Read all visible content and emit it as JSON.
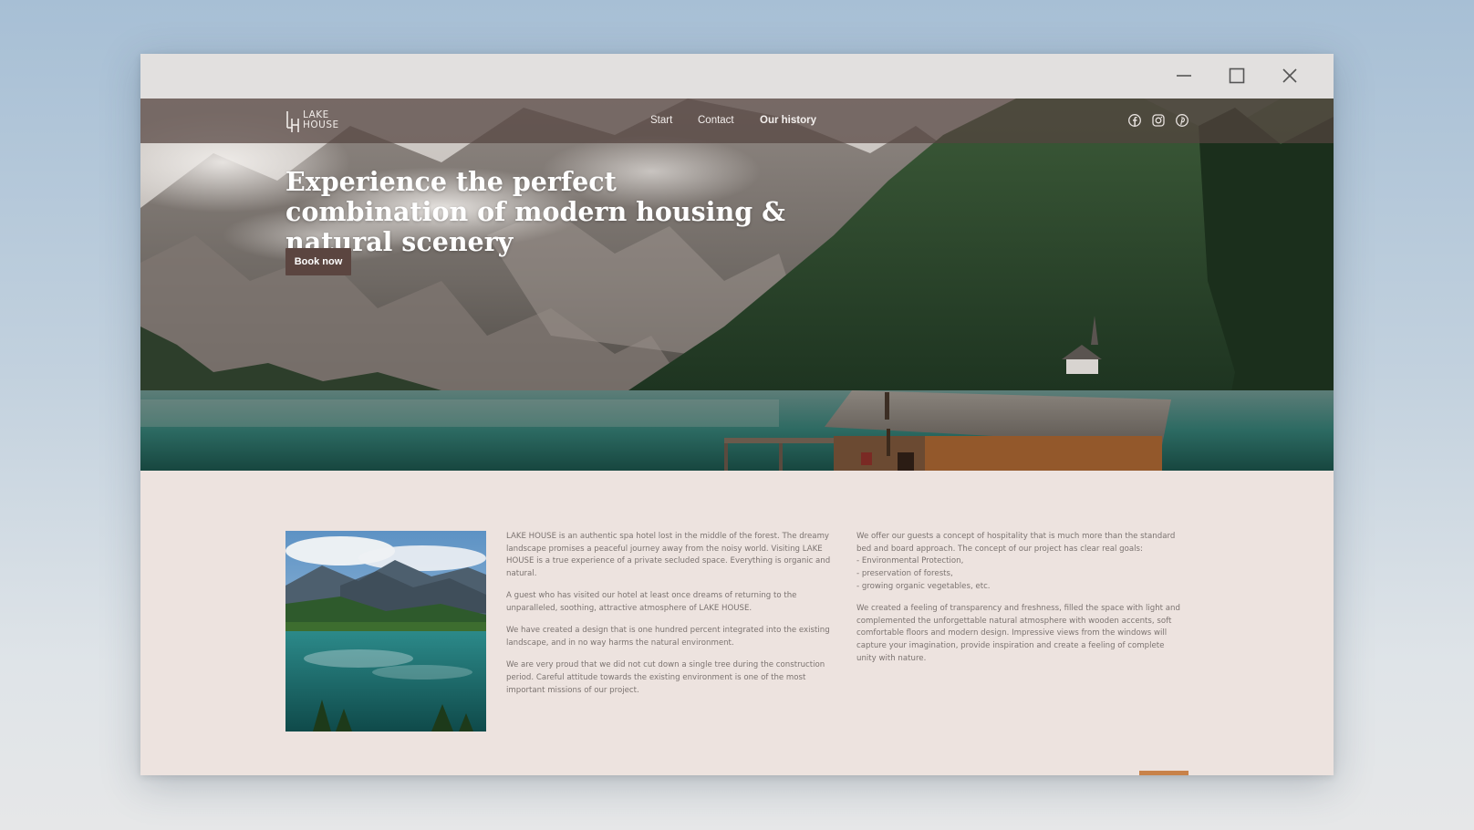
{
  "window": {
    "controls": {
      "minimize_icon": "minimize-icon",
      "maximize_icon": "maximize-icon",
      "close_icon": "close-icon"
    }
  },
  "nav": {
    "logo": {
      "line1": "LAKE",
      "line2": "HOUSE",
      "mark": "LH"
    },
    "links": [
      "Start",
      "Contact",
      "Our history"
    ],
    "active_link": "Our history",
    "social_icons": [
      "facebook-icon",
      "instagram-icon",
      "pinterest-icon"
    ]
  },
  "hero": {
    "title": "Experience the perfect combination of modern housing & natural scenery",
    "cta_label": "Book now"
  },
  "content": {
    "column1": [
      "LAKE HOUSE is an authentic spa hotel lost in the middle of the forest. The dreamy landscape promises a peaceful journey away from the noisy world. Visiting LAKE HOUSE is a true experience of a private secluded space. Everything is organic and natural.",
      "A guest who has visited our hotel at least once dreams of returning to the unparalleled, soothing, attractive atmosphere of LAKE HOUSE.",
      "We have created a design that is one hundred percent integrated into the existing landscape, and in no way harms the natural environment.",
      "We are very proud that we did not cut down a single tree during the construction period. Careful attitude towards the existing environment is one of the most important missions of our project."
    ],
    "column2": {
      "intro": "We offer our guests a concept of hospitality that is much more than the standard bed and board approach. The concept of our project has clear real goals:",
      "goals": [
        "- Environmental Protection,",
        "- preservation of forests,",
        "- growing organic vegetables, etc."
      ],
      "closing": "We created a feeling of transparency and freshness, filled the space with light and complemented the unforgettable natural atmosphere with wooden accents, soft comfortable floors and modern design. Impressive views from the windows will capture your imagination, provide inspiration and create a feeling of complete unity with nature."
    }
  },
  "colors": {
    "nav_bg": "#544440",
    "button_bg": "#5b4540",
    "content_bg": "#ede3df",
    "body_text": "#7b7370",
    "accent": "#c8824a"
  }
}
